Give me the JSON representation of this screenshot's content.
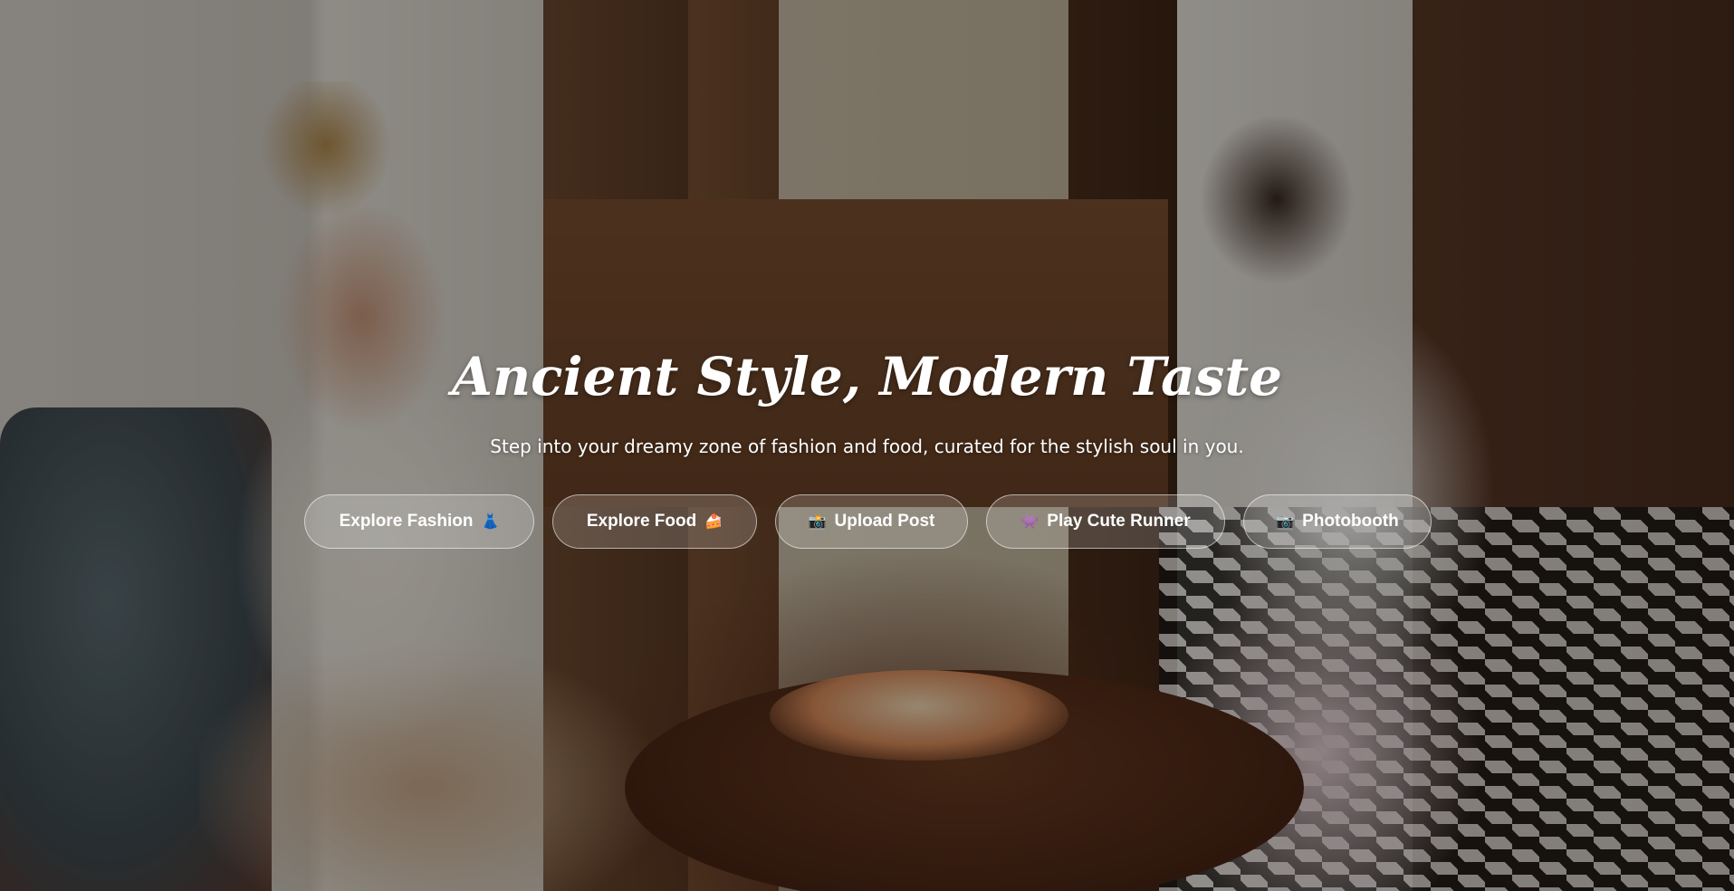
{
  "hero": {
    "title": "Ancient Style, Modern Taste",
    "subtitle": "Step into your dreamy zone of fashion and food, curated for the stylish soul in you."
  },
  "buttons": [
    {
      "label": "Explore Fashion",
      "icon": "👗",
      "icon_name": "dress-icon",
      "icon_position": "after"
    },
    {
      "label": "Explore Food",
      "icon": "🍰",
      "icon_name": "cake-icon",
      "icon_position": "after"
    },
    {
      "label": "Upload Post",
      "icon": "📸",
      "icon_name": "camera-icon",
      "icon_position": "before"
    },
    {
      "label": "Play Cute Runner",
      "icon": "👾",
      "icon_name": "alien-monster-icon",
      "icon_position": "before"
    },
    {
      "label": "Photobooth",
      "icon": "📷",
      "icon_name": "camera-icon",
      "icon_position": "before"
    }
  ],
  "colors": {
    "text": "#ffffff",
    "button_fill": "rgba(255,255,255,0.18)",
    "button_border": "rgba(255,255,255,0.55)",
    "overlay": "rgba(0,0,0,0.38)"
  }
}
